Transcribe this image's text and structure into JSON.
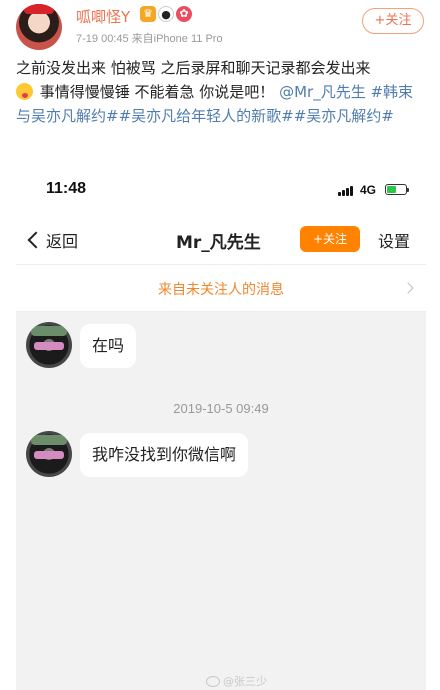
{
  "post": {
    "author": "呱唧怪Y",
    "badges": [
      "crown-badge-icon",
      "panda-badge-icon",
      "gift-badge-icon"
    ],
    "meta": "7-19 00:45  来自iPhone 11 Pro",
    "follow_label": "+关注",
    "text_part1": "之前没发出来 怕被骂 之后录屏和聊天记录都会发出来",
    "text_part2": " 事情得慢慢锤 不能着急 你说是吧！",
    "mention": "@Mr_凡先生",
    "hashtags": "#韩束与吴亦凡解约##吴亦凡给年轻人的新歌##吴亦凡解约#"
  },
  "screenshot": {
    "status": {
      "time": "11:48",
      "network": "4G"
    },
    "nav": {
      "back_label": "返回",
      "title": "Mr_凡先生",
      "follow_label": "+关注",
      "settings_label": "设置"
    },
    "notice": "来自未关注人的消息",
    "messages": [
      {
        "text": "在吗"
      },
      {
        "text": "我咋没找到你微信啊"
      }
    ],
    "timestamp": "2019-10-5 09:49",
    "watermark": "@张三少"
  },
  "colors": {
    "username": "#eb7350",
    "link": "#507daf",
    "follow_orange": "#ff8200",
    "notice_orange": "#f0872d",
    "chat_bg": "#f2f2f2"
  }
}
